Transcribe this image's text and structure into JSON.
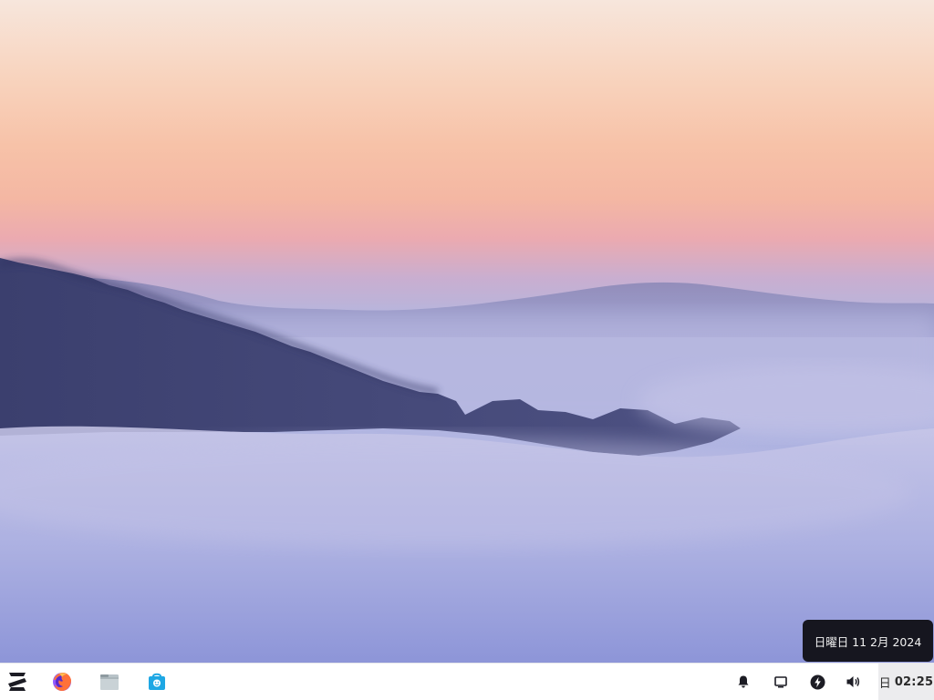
{
  "taskbar": {
    "launcher": {
      "icon": "zorin-logo-icon"
    },
    "pinned_apps": [
      {
        "name": "firefox",
        "icon": "firefox-icon"
      },
      {
        "name": "files",
        "icon": "files-folder-icon"
      },
      {
        "name": "software",
        "icon": "software-store-icon"
      }
    ],
    "tray": [
      {
        "name": "notifications",
        "icon": "bell-icon"
      },
      {
        "name": "display",
        "icon": "screen-icon"
      },
      {
        "name": "power",
        "icon": "power-bolt-icon"
      },
      {
        "name": "volume",
        "icon": "speaker-icon"
      }
    ],
    "clock": {
      "day": "日",
      "time": "02:25"
    }
  },
  "tooltip": {
    "text": "日曜日 11 2月 2024"
  },
  "colors": {
    "taskbar_bg": "#ffffff",
    "clock_bg": "#ececee",
    "tooltip_bg": "#16161f",
    "icon_dark": "#1c1c24",
    "firefox_orange": "#ff7139",
    "firefox_purple": "#9059ff",
    "files_gray": "#b8c3c8",
    "store_blue": "#1ea7e4"
  }
}
